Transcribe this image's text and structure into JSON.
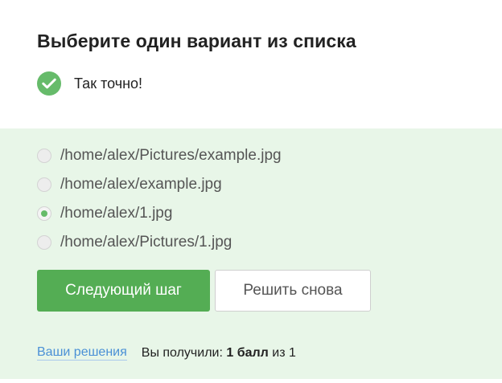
{
  "quiz": {
    "title": "Выберите один вариант из списка",
    "status_text": "Так точно!",
    "status_icon": "checkmark-icon",
    "accent_color": "#66bb6a"
  },
  "options": [
    {
      "label": "/home/alex/Pictures/example.jpg",
      "selected": false
    },
    {
      "label": "/home/alex/example.jpg",
      "selected": false
    },
    {
      "label": "/home/alex/1.jpg",
      "selected": true
    },
    {
      "label": "/home/alex/Pictures/1.jpg",
      "selected": false
    }
  ],
  "buttons": {
    "next_label": "Следующий шаг",
    "retry_label": "Решить снова"
  },
  "footer": {
    "solutions_link": "Ваши решения",
    "score_prefix": "Вы получили:",
    "score_value": "1 балл",
    "score_suffix": "из 1"
  }
}
